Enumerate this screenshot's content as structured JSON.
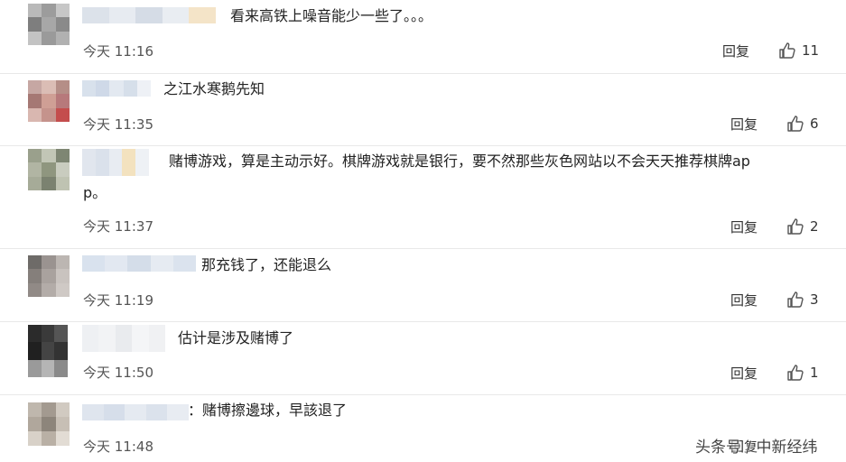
{
  "comments": [
    {
      "text": "看来高铁上噪音能少一些了。。。",
      "time": "今天 11:16",
      "reply": "回复",
      "likes": "11",
      "avatar_colors": [
        "#b9b9b9",
        "#9c9c9c",
        "#c7c7c7",
        "#7e7e7e",
        "#a7a7a7",
        "#8a8a8a",
        "#c3c3c3",
        "#9a9a9a",
        "#b1b1b1"
      ],
      "name_colors": [
        "#dce2ea",
        "#e7ebf1",
        "#d5dce6",
        "#e9edf2",
        "#f4e4c8"
      ]
    },
    {
      "text": "之江水寒鹅先知",
      "time": "今天 11:35",
      "reply": "回复",
      "likes": "6",
      "avatar_colors": [
        "#c6a7a3",
        "#dbbdb5",
        "#b58e87",
        "#a57874",
        "#cf9f95",
        "#b7797b",
        "#d9b7b0",
        "#c5938c",
        "#c44d4d"
      ],
      "name_colors": [
        "#d8e1ec",
        "#cfd9e8",
        "#e3e9f1",
        "#d6dfea",
        "#eef1f6"
      ]
    },
    {
      "text": "赌博游戏，算是主动示好。棋牌游戏就是银行，要不然那些灰色网站以不会天天推荐棋牌ap",
      "text2": "p。",
      "time": "今天 11:37",
      "reply": "回复",
      "likes": "2",
      "avatar_colors": [
        "#9aa08c",
        "#c2c6b6",
        "#7e8673",
        "#b1b5a3",
        "#8f967f",
        "#c9ccbf",
        "#a6ab98",
        "#7b8270",
        "#bfc3b2"
      ],
      "name_colors": [
        "#e1e6ee",
        "#dae1eb",
        "#e8ecf2",
        "#f3e2bf",
        "#eef1f5"
      ]
    },
    {
      "text": "那充钱了，还能退么",
      "time": "今天 11:19",
      "reply": "回复",
      "likes": "3",
      "avatar_colors": [
        "#6e6b68",
        "#9a9390",
        "#bcb6b2",
        "#857f7b",
        "#a9a29e",
        "#c9c3bf",
        "#918a86",
        "#b3aca8",
        "#cfc9c5"
      ],
      "name_colors": [
        "#d9e2ee",
        "#e2e8f1",
        "#d4dde9",
        "#e6ebf2",
        "#dbe3ee"
      ]
    },
    {
      "text": "估计是涉及赌博了",
      "time": "今天 11:50",
      "reply": "回复",
      "likes": "1",
      "avatar_colors": [
        "#2b2b2b",
        "#3a3a3a",
        "#555555",
        "#202020",
        "#444444",
        "#333333",
        "#9a9a9a",
        "#b5b5b5",
        "#8a8a8a"
      ],
      "name_colors": [
        "#eef0f3",
        "#f2f3f5",
        "#e9ebee",
        "#f4f5f7",
        "#f0f1f3"
      ]
    },
    {
      "text": "：赌博擦邊球，早該退了",
      "time": "今天 11:48",
      "reply": "回复",
      "likes": "",
      "avatar_colors": [
        "#bfb7ad",
        "#a39a90",
        "#d1cac1",
        "#b0a79c",
        "#8d857b",
        "#c7bfb5",
        "#d8d1c8",
        "#b9b0a5",
        "#e2dcd4"
      ],
      "name_colors": [
        "#dfe5ee",
        "#d6deea",
        "#e5eaf1",
        "#dbe2ec",
        "#e8ecf2"
      ]
    }
  ],
  "watermark": "头条号 / 中新经纬"
}
